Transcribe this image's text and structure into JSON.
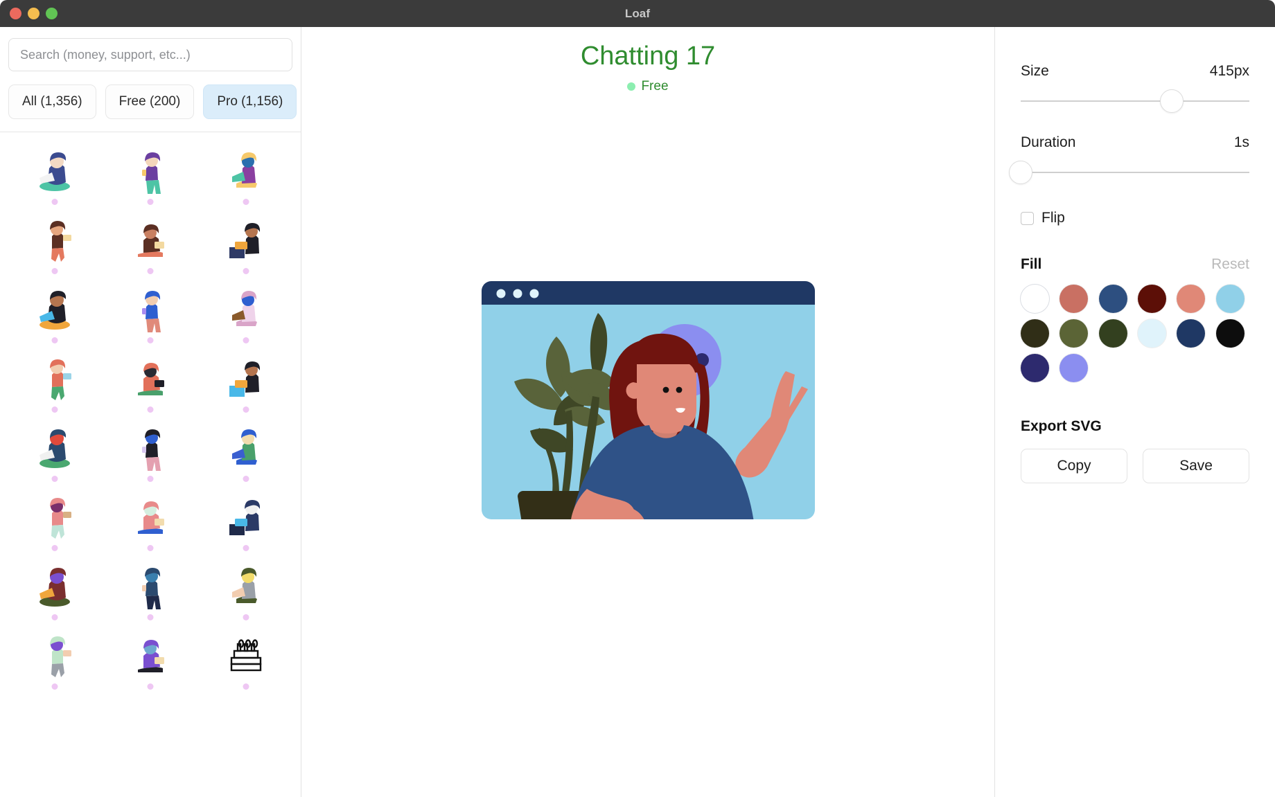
{
  "window": {
    "title": "Loaf",
    "traffic_lights": [
      "close-red",
      "minimize-yellow",
      "zoom-green"
    ]
  },
  "sidebar": {
    "search": {
      "placeholder": "Search (money, support, etc...)",
      "value": "",
      "icon": "search-icon"
    },
    "filters": [
      {
        "label": "All (1,356)",
        "active": false,
        "count": "1,356",
        "name": "all"
      },
      {
        "label": "Free (200)",
        "active": false,
        "count": "200",
        "name": "free"
      },
      {
        "label": "Pro (1,156)",
        "active": true,
        "count": "1,156",
        "name": "pro"
      }
    ],
    "thumbnail_dot_color": "#eec7f3",
    "thumbnails": [
      {
        "id": 1,
        "name": "woman-on-beanbag-with-laptop"
      },
      {
        "id": 2,
        "name": "woman-standing-with-phone"
      },
      {
        "id": 3,
        "name": "woman-on-sofa-with-laptop"
      },
      {
        "id": 4,
        "name": "woman-sitting-laptop-left"
      },
      {
        "id": 5,
        "name": "woman-sitting-laptop-left-2"
      },
      {
        "id": 6,
        "name": "woman-cross-legged-laptop"
      },
      {
        "id": 7,
        "name": "woman-cross-legged-laptop-2"
      },
      {
        "id": 8,
        "name": "woman-leaning-with-tablet"
      },
      {
        "id": 9,
        "name": "woman-walking-with-phone"
      },
      {
        "id": 10,
        "name": "woman-sitting-with-tablet"
      },
      {
        "id": 11,
        "name": "woman-standing-with-phone-2"
      },
      {
        "id": 12,
        "name": "man-walking-with-phone"
      },
      {
        "id": 13,
        "name": "man-in-armchair-with-tablet"
      },
      {
        "id": 14,
        "name": "woman-at-desk-with-laptop-boxes"
      },
      {
        "id": 15,
        "name": "man-celebrating-at-laptop"
      },
      {
        "id": 16,
        "name": "woman-at-desk-on-chair"
      },
      {
        "id": 17,
        "name": "man-seated-with-laptop"
      },
      {
        "id": 18,
        "name": "man-walking-with-tablet"
      },
      {
        "id": 19,
        "name": "man-at-desktop-computer"
      },
      {
        "id": 20,
        "name": "man-sitting-on-bench-waving"
      },
      {
        "id": 21,
        "name": "man-lying-with-phone"
      },
      {
        "id": 22,
        "name": "two-people-lying-with-phones"
      },
      {
        "id": 23,
        "name": "man-crouching-with-drink"
      },
      {
        "id": 24,
        "name": "birthday-cake-outline"
      }
    ]
  },
  "canvas": {
    "title": "Chatting 17",
    "badge": "Free",
    "badge_dot_color": "#8ceeb0",
    "title_color": "#2f8c2f",
    "illustration": {
      "name": "chatting-illustration",
      "browser_bar_color": "#1f3864",
      "screen_color": "#90d0e8",
      "hair_color": "#70140f",
      "skin_color": "#e08877",
      "shirt_color": "#2f5287",
      "bubble_color": "#8b8ef0",
      "bubble_dot_color": "#2d2a6e",
      "plant_leaf_color": "#3f4726",
      "plant_leaf_color_2": "#59633a",
      "pot_color": "#332f17"
    }
  },
  "panel": {
    "size": {
      "label": "Size",
      "value": "415px",
      "percent": 66
    },
    "duration": {
      "label": "Duration",
      "value": "1s",
      "percent": 0
    },
    "flip": {
      "label": "Flip",
      "checked": false
    },
    "fill": {
      "title": "Fill",
      "reset_label": "Reset",
      "swatches": [
        {
          "color": "#ffffff",
          "name": "white"
        },
        {
          "color": "#c97063",
          "name": "clay-rose"
        },
        {
          "color": "#2d4f80",
          "name": "denim-blue"
        },
        {
          "color": "#5c0f07",
          "name": "dark-maroon"
        },
        {
          "color": "#e08877",
          "name": "salmon"
        },
        {
          "color": "#90d0e8",
          "name": "sky-blue"
        },
        {
          "color": "#302e17",
          "name": "very-dark-olive"
        },
        {
          "color": "#5b6436",
          "name": "olive-green"
        },
        {
          "color": "#33401f",
          "name": "dark-forest"
        },
        {
          "color": "#e0f3fb",
          "name": "pale-ice-blue"
        },
        {
          "color": "#1f3864",
          "name": "navy"
        },
        {
          "color": "#0d0d0d",
          "name": "near-black"
        },
        {
          "color": "#2d2a6e",
          "name": "indigo"
        },
        {
          "color": "#8b8ef0",
          "name": "periwinkle"
        }
      ]
    },
    "export": {
      "title": "Export SVG",
      "copy_label": "Copy",
      "save_label": "Save"
    }
  }
}
